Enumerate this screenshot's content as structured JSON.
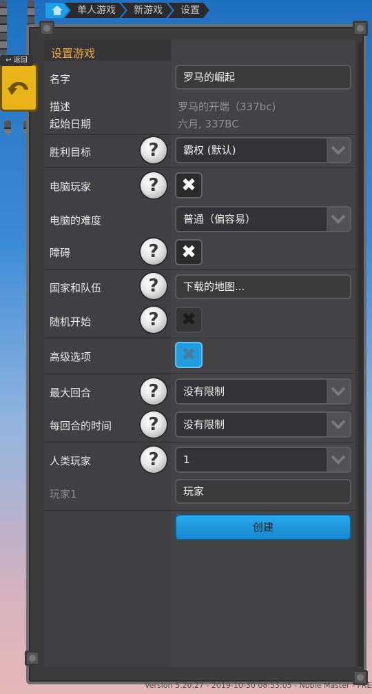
{
  "breadcrumb": {
    "home_icon": "home-icon",
    "items": [
      "单人游戏",
      "新游戏",
      "设置"
    ]
  },
  "back_button": {
    "label": "返回",
    "icon": "back-arrow-icon"
  },
  "section_title": "设置游戏",
  "name": {
    "label": "名字",
    "value": "罗马的崛起"
  },
  "description": {
    "label": "描述",
    "value": "罗马的开端（337bc)"
  },
  "start_date": {
    "label": "起始日期",
    "value": "六月, 337BC"
  },
  "victory_goal": {
    "label": "胜利目标",
    "value": "霸权 (默认)"
  },
  "ai_player": {
    "label": "电脑玩家",
    "checked": true
  },
  "ai_difficulty": {
    "label": "电脑的难度",
    "value": "普通（偏容易）"
  },
  "obstacles": {
    "label": "障碍",
    "checked": true
  },
  "nations_teams": {
    "label": "国家和队伍",
    "value": "下载的地图..."
  },
  "random_start": {
    "label": "随机开始",
    "checked": true
  },
  "advanced_options": {
    "label": "高级选项",
    "checked": false
  },
  "max_turns": {
    "label": "最大回合",
    "value": "没有限制"
  },
  "turn_time": {
    "label": "每回合的时间",
    "value": "没有限制"
  },
  "human_players": {
    "label": "人类玩家",
    "value": "1"
  },
  "player1": {
    "label": "玩家1",
    "value": "玩家"
  },
  "create_button": "创建",
  "version_text": "Version 5.20.27 - 2019-10-30 08:53:05 - Noble Master - FREE",
  "colors": {
    "accent": "#f0a542",
    "create": "#1a98e0",
    "checkbox_active": "#1e9de0"
  }
}
